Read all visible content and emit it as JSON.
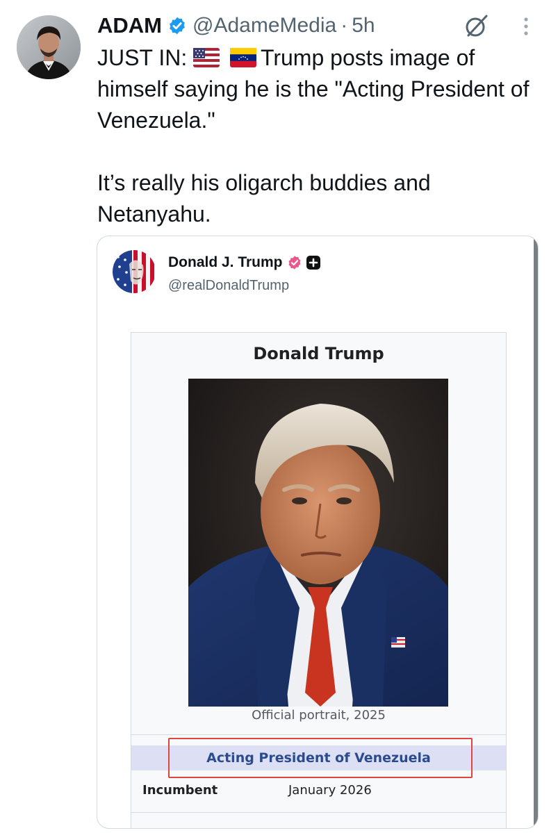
{
  "author": {
    "name": "ADAM",
    "handle": "@AdameMedia",
    "separator": "·",
    "timestamp": "5h"
  },
  "tweet": {
    "line1_prefix": "JUST IN:",
    "flags": [
      "us-flag-emoji",
      "venezuela-flag-emoji"
    ],
    "line1_text": "Trump posts image of himself saying he is the \"Acting President of Venezuela.\"",
    "paragraph2": "It’s really his oligarch buddies and Netanyahu."
  },
  "embedded_post": {
    "name": "Donald J. Trump",
    "handle": "@realDonaldTrump",
    "infobox": {
      "title": "Donald Trump",
      "caption": "Official portrait, 2025",
      "office": "Acting President of Venezuela",
      "row_label": "Incumbent",
      "row_value": "January 2026"
    }
  },
  "colors": {
    "verified_blue": "#1d9bf0",
    "verified_pink": "#e8588c",
    "highlight_red": "#e0443e",
    "link_blue": "#2a4b8d"
  },
  "icons": [
    "verified-badge-icon",
    "grok-icon",
    "more-options-icon",
    "plus-badge-icon"
  ]
}
